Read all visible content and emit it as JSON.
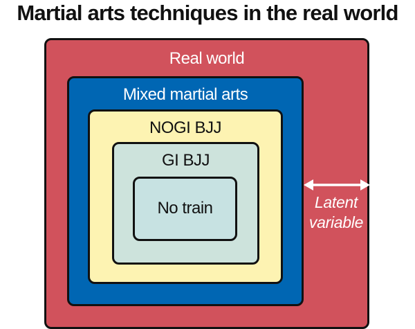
{
  "title": "Martial arts techniques in the real world",
  "colors": {
    "real_world": "#d1525c",
    "mixed_martial_arts": "#0066b3",
    "nogi_bjj": "#fdf3b2",
    "gi_bjj": "#cde3dc",
    "no_train": "#c7e2e2",
    "outline": "#111111",
    "arrow": "#ffffff"
  },
  "boxes": {
    "real_world": {
      "label": "Real world"
    },
    "mixed_martial_arts": {
      "label": "Mixed martial arts"
    },
    "nogi_bjj": {
      "label": "NOGI BJJ"
    },
    "gi_bjj": {
      "label": "GI BJJ"
    },
    "no_train": {
      "label": "No train"
    }
  },
  "annotation": {
    "line1": "Latent",
    "line2": "variable",
    "arrow": "double-headed-arrow-icon"
  }
}
